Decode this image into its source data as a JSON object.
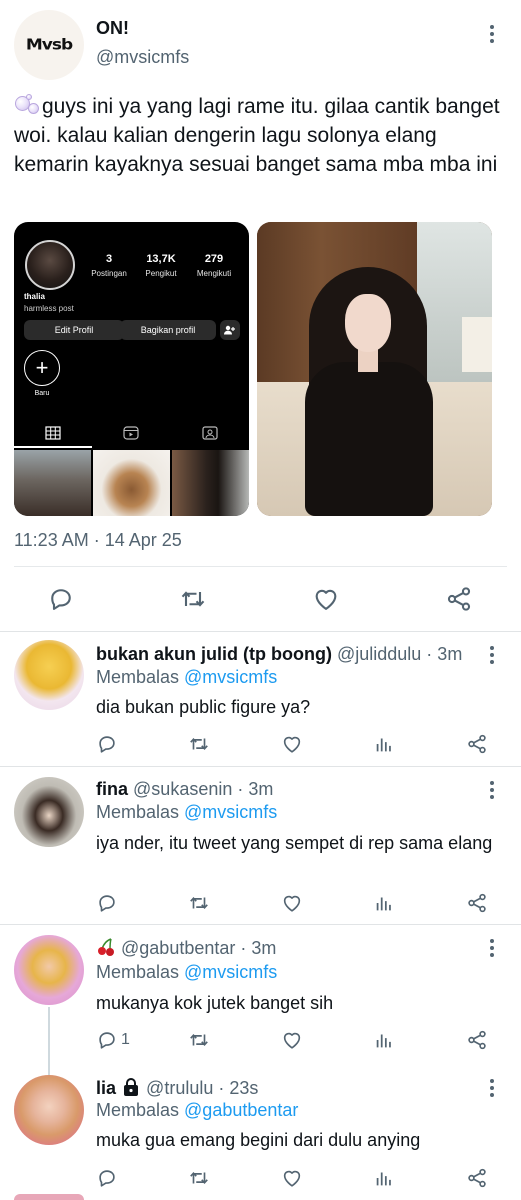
{
  "tweet": {
    "name": "ON!",
    "handle": "@mvsicmfs",
    "avatar_logo_text": "Mvsb",
    "text": "guys ini ya yang lagi rame itu. gilaa cantik banget woi. kalau kalian dengerin lagu solonya elang kemarin kayaknya sesuai banget sama mba mba ini",
    "timestamp": "11:23 AM · 14 Apr 25",
    "actions": [
      "reply-icon",
      "retweet-icon",
      "like-icon",
      "share-icon"
    ]
  },
  "media_profile_screenshot": {
    "stats": [
      {
        "num": "3",
        "label": "Postingan"
      },
      {
        "num": "13,7K",
        "label": "Pengikut"
      },
      {
        "num": "279",
        "label": "Mengikuti"
      }
    ],
    "name": "thalia",
    "bio": "harmless post",
    "edit_button": "Edit Profil",
    "share_button": "Bagikan profil",
    "new_label": "Baru"
  },
  "replies": [
    {
      "name": "bukan akun julid (tp boong)",
      "handle": "@juliddulu · 3m",
      "reply_prefix": "Membalas ",
      "reply_to": "@mvsicmfs",
      "text": "dia bukan public figure ya?",
      "reply_count": ""
    },
    {
      "name": "fina",
      "handle": "@sukasenin · 3m",
      "reply_prefix": "Membalas ",
      "reply_to": "@mvsicmfs",
      "text": "iya nder, itu tweet yang sempet di rep sama elang",
      "reply_count": ""
    },
    {
      "name": "",
      "handle": "@gabutbentar · 3m",
      "reply_prefix": "Membalas ",
      "reply_to": "@mvsicmfs",
      "text": "mukanya kok jutek banget sih",
      "reply_count": "1"
    },
    {
      "name": "lia",
      "handle": "@trululu · 23s",
      "reply_prefix": "Membalas ",
      "reply_to": "@gabutbentar",
      "text": "muka gua emang begini dari dulu anying",
      "reply_count": ""
    }
  ],
  "colors": {
    "text": "#0f1419",
    "secondary": "#536471",
    "link": "#1d9bf0",
    "divider": "#e1e4e6"
  }
}
